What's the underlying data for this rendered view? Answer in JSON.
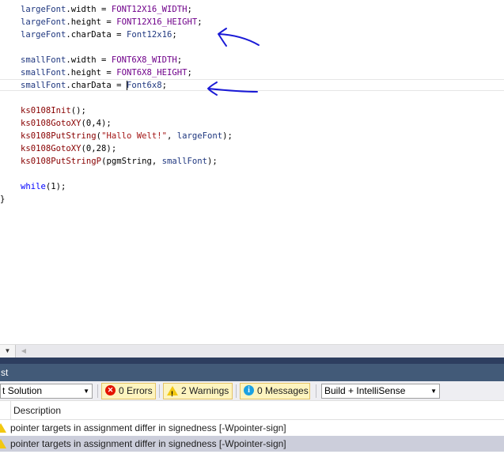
{
  "editor": {
    "lines": [
      [
        {
          "t": "largeFont",
          "c": "#1f377f"
        },
        {
          "t": ".width = ",
          "c": "#000000"
        },
        {
          "t": "FONT12X16_WIDTH",
          "c": "#6f008a"
        },
        {
          "t": ";",
          "c": "#000000"
        }
      ],
      [
        {
          "t": "largeFont",
          "c": "#1f377f"
        },
        {
          "t": ".height = ",
          "c": "#000000"
        },
        {
          "t": "FONT12X16_HEIGHT",
          "c": "#6f008a"
        },
        {
          "t": ";",
          "c": "#000000"
        }
      ],
      [
        {
          "t": "largeFont",
          "c": "#1f377f"
        },
        {
          "t": ".charData = ",
          "c": "#000000"
        },
        {
          "t": "Font12x16",
          "c": "#1f377f"
        },
        {
          "t": ";",
          "c": "#000000"
        }
      ],
      [],
      [
        {
          "t": "smallFont",
          "c": "#1f377f"
        },
        {
          "t": ".width = ",
          "c": "#000000"
        },
        {
          "t": "FONT6X8_WIDTH",
          "c": "#6f008a"
        },
        {
          "t": ";",
          "c": "#000000"
        }
      ],
      [
        {
          "t": "smallFont",
          "c": "#1f377f"
        },
        {
          "t": ".height = ",
          "c": "#000000"
        },
        {
          "t": "FONT6X8_HEIGHT",
          "c": "#6f008a"
        },
        {
          "t": ";",
          "c": "#000000"
        }
      ],
      [
        {
          "t": "smallFont",
          "c": "#1f377f"
        },
        {
          "t": ".charData = ",
          "c": "#000000"
        },
        {
          "t": "Font6x8",
          "c": "#1f377f"
        },
        {
          "t": ";",
          "c": "#000000"
        }
      ],
      [],
      [
        {
          "t": "ks0108Init",
          "c": "#880000"
        },
        {
          "t": "();",
          "c": "#000000"
        }
      ],
      [
        {
          "t": "ks0108GotoXY",
          "c": "#880000"
        },
        {
          "t": "(0,4);",
          "c": "#000000"
        }
      ],
      [
        {
          "t": "ks0108PutString",
          "c": "#880000"
        },
        {
          "t": "(",
          "c": "#000000"
        },
        {
          "t": "\"Hallo Welt!\"",
          "c": "#a31515"
        },
        {
          "t": ", ",
          "c": "#000000"
        },
        {
          "t": "largeFont",
          "c": "#1f377f"
        },
        {
          "t": ");",
          "c": "#000000"
        }
      ],
      [
        {
          "t": "ks0108GotoXY",
          "c": "#880000"
        },
        {
          "t": "(0,28);",
          "c": "#000000"
        }
      ],
      [
        {
          "t": "ks0108PutStringP",
          "c": "#880000"
        },
        {
          "t": "(pgmString, ",
          "c": "#000000"
        },
        {
          "t": "smallFont",
          "c": "#1f377f"
        },
        {
          "t": ");",
          "c": "#000000"
        }
      ],
      [],
      [
        {
          "t": "while",
          "c": "#0000ff"
        },
        {
          "t": "(1);",
          "c": "#000000"
        }
      ]
    ],
    "closing_brace": "}"
  },
  "panel": {
    "title": "st",
    "scope_value": "Solution",
    "scope_prefix": "t",
    "errors_label": "0 Errors",
    "warnings_label": "2 Warnings",
    "messages_label": "0 Messages",
    "build_filter_value": "Build + IntelliSense",
    "column_description": "Description",
    "rows": [
      {
        "description": "pointer targets in assignment differ in signedness [-Wpointer-sign]",
        "selected": false
      },
      {
        "description": "pointer targets in assignment differ in signedness [-Wpointer-sign]",
        "selected": true
      }
    ]
  },
  "colors": {
    "annotation_arrows": "#1a1ad6",
    "panel_header": "#425a78",
    "selected_row": "#cccedb",
    "filter_button_bg": "#fdf4bf"
  }
}
